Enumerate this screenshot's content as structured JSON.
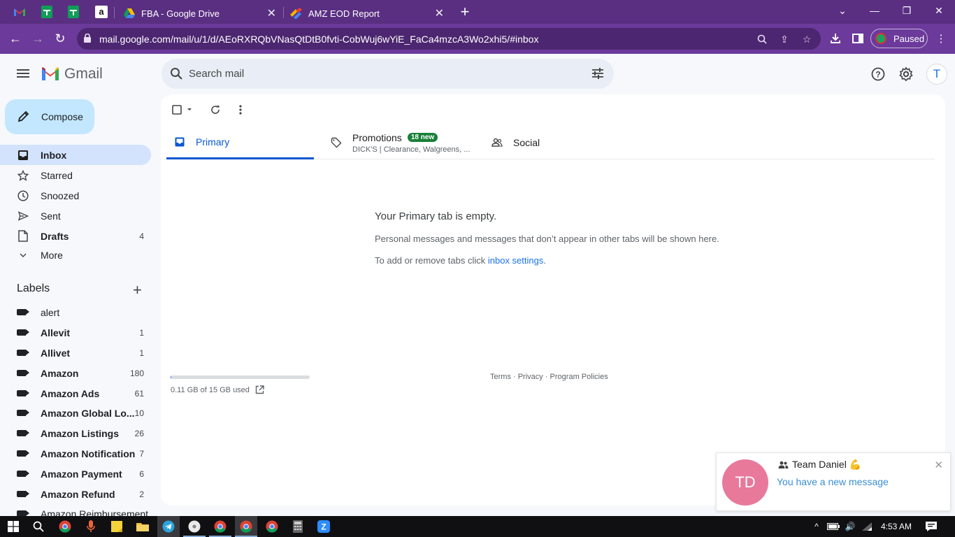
{
  "browser": {
    "tabs": [
      {
        "title": "FBA - Google Drive",
        "icon": "google-drive-icon"
      },
      {
        "title": "AMZ EOD Report",
        "icon": "report-icon"
      }
    ],
    "pinned_tabs": [
      "gmail-icon",
      "google-sheets-icon",
      "google-sheets-icon",
      "amazon-icon"
    ],
    "url": "mail.google.com/mail/u/1/d/AEoRXRQbVNasQtDtB0fvti-CobWuj6wYiE_FaCa4mzcA3Wo2xhi5/#inbox",
    "profile_status": "Paused"
  },
  "gmail": {
    "logo_text": "Gmail",
    "search_placeholder": "Search mail",
    "account_initial": "T",
    "compose_label": "Compose",
    "nav": [
      {
        "label": "Inbox",
        "icon": "inbox-icon",
        "count": "",
        "active": true
      },
      {
        "label": "Starred",
        "icon": "star-icon",
        "count": ""
      },
      {
        "label": "Snoozed",
        "icon": "clock-icon",
        "count": ""
      },
      {
        "label": "Sent",
        "icon": "send-icon",
        "count": ""
      },
      {
        "label": "Drafts",
        "icon": "draft-icon",
        "count": "4"
      },
      {
        "label": "More",
        "icon": "chevron-down-icon",
        "count": ""
      }
    ],
    "labels_title": "Labels",
    "labels": [
      {
        "name": "alert",
        "count": ""
      },
      {
        "name": "Allevit",
        "count": "1"
      },
      {
        "name": "Allivet",
        "count": "1"
      },
      {
        "name": "Amazon",
        "count": "180"
      },
      {
        "name": "Amazon Ads",
        "count": "61"
      },
      {
        "name": "Amazon Global Lo...",
        "count": "10"
      },
      {
        "name": "Amazon Listings",
        "count": "26"
      },
      {
        "name": "Amazon Notification",
        "count": "7"
      },
      {
        "name": "Amazon Payment",
        "count": "6"
      },
      {
        "name": "Amazon Refund",
        "count": "2"
      },
      {
        "name": "Amazon Reimbursement",
        "count": ""
      }
    ],
    "tabs": {
      "primary": "Primary",
      "promotions": "Promotions",
      "promotions_badge": "18 new",
      "promotions_preview": "DICK'S | Clearance, Walgreens, ...",
      "social": "Social"
    },
    "empty": {
      "title": "Your Primary tab is empty.",
      "description": "Personal messages and messages that don’t appear in other tabs will be shown here.",
      "settings_prefix": "To add or remove tabs click ",
      "settings_link": "inbox settings",
      "settings_suffix": "."
    },
    "storage": {
      "text": "0.11 GB of 15 GB used",
      "fraction": 0.0073
    },
    "footer": "Terms · Privacy · Program Policies"
  },
  "notification": {
    "initials": "TD",
    "title": "Team Daniel 💪",
    "message": "You have a new message"
  },
  "taskbar": {
    "time": "4:53 AM"
  }
}
